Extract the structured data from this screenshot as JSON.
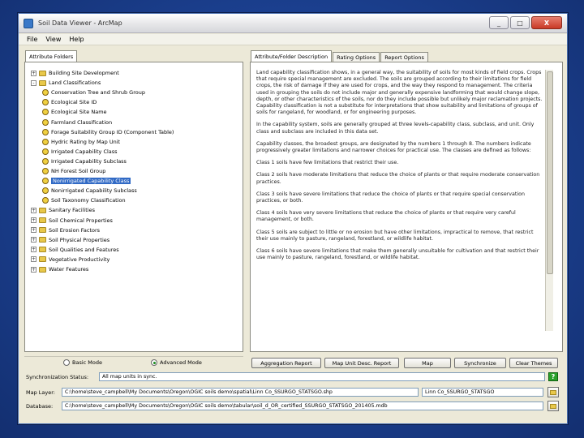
{
  "window": {
    "title": "Soil Data Viewer - ArcMap",
    "minimize": "_",
    "maximize": "□",
    "close": "X"
  },
  "menu": [
    "File",
    "View",
    "Help"
  ],
  "left_tab": "Attribute Folders",
  "tree": [
    {
      "level": 0,
      "type": "folder",
      "expander": "+",
      "label": "Building Site Development"
    },
    {
      "level": 0,
      "type": "folder",
      "expander": "-",
      "label": "Land Classifications"
    },
    {
      "level": 1,
      "type": "leaf",
      "label": "Conservation Tree and Shrub Group"
    },
    {
      "level": 1,
      "type": "leaf",
      "label": "Ecological Site ID"
    },
    {
      "level": 1,
      "type": "leaf",
      "label": "Ecological Site Name"
    },
    {
      "level": 1,
      "type": "leaf",
      "label": "Farmland Classification"
    },
    {
      "level": 1,
      "type": "leaf",
      "label": "Forage Suitability Group ID (Component Table)"
    },
    {
      "level": 1,
      "type": "leaf",
      "label": "Hydric Rating by Map Unit"
    },
    {
      "level": 1,
      "type": "leaf",
      "label": "Irrigated Capability Class"
    },
    {
      "level": 1,
      "type": "leaf",
      "label": "Irrigated Capability Subclass"
    },
    {
      "level": 1,
      "type": "leaf",
      "label": "NH Forest Soil Group"
    },
    {
      "level": 1,
      "type": "leaf",
      "label": "Nonirrigated Capability Class",
      "selected": true
    },
    {
      "level": 1,
      "type": "leaf",
      "label": "Nonirrigated Capability Subclass"
    },
    {
      "level": 1,
      "type": "leaf",
      "label": "Soil Taxonomy Classification"
    },
    {
      "level": 0,
      "type": "folder",
      "expander": "+",
      "label": "Sanitary Facilities"
    },
    {
      "level": 0,
      "type": "folder",
      "expander": "+",
      "label": "Soil Chemical Properties"
    },
    {
      "level": 0,
      "type": "folder",
      "expander": "+",
      "label": "Soil Erosion Factors"
    },
    {
      "level": 0,
      "type": "folder",
      "expander": "+",
      "label": "Soil Physical Properties"
    },
    {
      "level": 0,
      "type": "folder",
      "expander": "+",
      "label": "Soil Qualities and Features"
    },
    {
      "level": 0,
      "type": "folder",
      "expander": "+",
      "label": "Vegetative Productivity"
    },
    {
      "level": 0,
      "type": "folder",
      "expander": "+",
      "label": "Water Features"
    }
  ],
  "right_tabs": [
    "Attribute/Folder Description",
    "Rating Options",
    "Report Options"
  ],
  "description": [
    "Land capability classification shows, in a general way, the suitability of soils for most kinds of field crops. Crops that require special management are excluded. The soils are grouped according to their limitations for field crops, the risk of damage if they are used for crops, and the way they respond to management. The criteria used in grouping the soils do not include major and generally expensive landforming that would change slope, depth, or other characteristics of the soils, nor do they include possible but unlikely major reclamation projects. Capability classification is not a substitute for interpretations that show suitability and limitations of groups of soils for rangeland, for woodland, or for engineering purposes.",
    "In the capability system, soils are generally grouped at three levels-capability class, subclass, and unit. Only class and subclass are included in this data set.",
    "Capability classes, the broadest groups, are designated by the numbers 1 through 8. The numbers indicate progressively greater limitations and narrower choices for practical use. The classes are defined as follows:",
    "Class 1 soils have few limitations that restrict their use.",
    "Class 2 soils have moderate limitations that reduce the choice of plants or that require moderate conservation practices.",
    "Class 3 soils have severe limitations that reduce the choice of plants or that require special conservation practices, or both.",
    "Class 4 soils have very severe limitations that reduce the choice of plants or that require very careful management, or both.",
    "Class 5 soils are subject to little or no erosion but have other limitations, impractical to remove, that restrict their use mainly to pasture, rangeland, forestland, or wildlife habitat.",
    "Class 6 soils have severe limitations that make them generally unsuitable for cultivation and that restrict their use mainly to pasture, rangeland, forestland, or wildlife habitat."
  ],
  "modes": {
    "basic": "Basic Mode",
    "advanced": "Advanced Mode",
    "selected": "advanced"
  },
  "buttons": {
    "aggregation": "Aggregation Report",
    "mapunit": "Map Unit Desc. Report",
    "map": "Map",
    "synchronize": "Synchronize",
    "clear": "Clear Themes"
  },
  "status": {
    "sync_label": "Synchronization Status:",
    "sync_value": "All map units in sync.",
    "ok_mark": "?",
    "map_layer_label": "Map Layer:",
    "map_layer_path": "C:\\home\\steve_campbell\\My Documents\\Oregon\\OGIC soils demo\\spatial\\Linn Co_SSURGO_STATSGO.shp",
    "map_layer_name": "Linn Co_SSURGO_STATSGO",
    "database_label": "Database:",
    "database_path": "C:\\home\\steve_campbell\\My Documents\\Oregon\\OGIC soils demo\\tabular\\soil_d_OR_certified_SSURGO_STATSGO_201405.mdb"
  }
}
